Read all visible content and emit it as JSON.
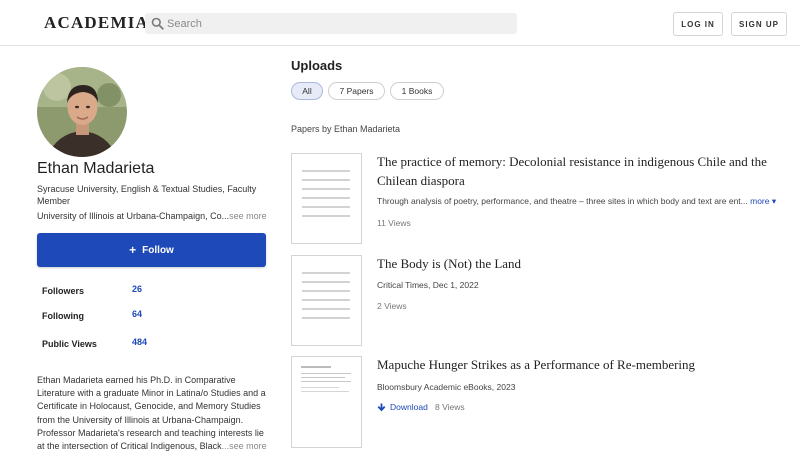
{
  "header": {
    "logo": "ACADEMIA",
    "search_placeholder": "Search",
    "login_label": "LOG IN",
    "signup_label": "SIGN UP"
  },
  "profile": {
    "name": "Ethan Madarieta",
    "affiliation": "Syracuse University, English & Textual Studies, Faculty Member",
    "secondary_affiliation": "University of Illinois at Urbana-Champaign, Co...",
    "see_more": "see more",
    "follow_label": "Follow",
    "stats": [
      {
        "label": "Followers",
        "value": "26"
      },
      {
        "label": "Following",
        "value": "64"
      },
      {
        "label": "Public Views",
        "value": "484"
      }
    ],
    "bio": "Ethan Madarieta earned his Ph.D. in Comparative Literature with a graduate Minor in Latina/o Studies and a Certificate in Holocaust, Genocide, and Memory Studies from the University of Illinois at Urbana-Champaign. Professor Madarieta's research and teaching interests lie at the intersection of Critical Indigenous, Black",
    "bio_more": "...see more"
  },
  "uploads": {
    "title": "Uploads",
    "filters": [
      {
        "label": "All",
        "active": true
      },
      {
        "label": "7 Papers",
        "active": false
      },
      {
        "label": "1 Books",
        "active": false
      }
    ],
    "section_label": "Papers by Ethan Madarieta",
    "papers": [
      {
        "title": "The practice of memory: Decolonial resistance in indigenous Chile and the Chilean diaspora",
        "description": "Through analysis of poetry, performance, and theatre – three sites in which body and text are ent...",
        "more": "more",
        "views": "11 Views"
      },
      {
        "title": "The Body is (Not) the Land",
        "meta": "Critical Times, Dec 1, 2022",
        "views": "2 Views"
      },
      {
        "title": "Mapuche Hunger Strikes as a Performance of Re-membering",
        "meta": "Bloomsbury Academic eBooks, 2023",
        "download": "Download",
        "views": "8 Views"
      }
    ]
  }
}
